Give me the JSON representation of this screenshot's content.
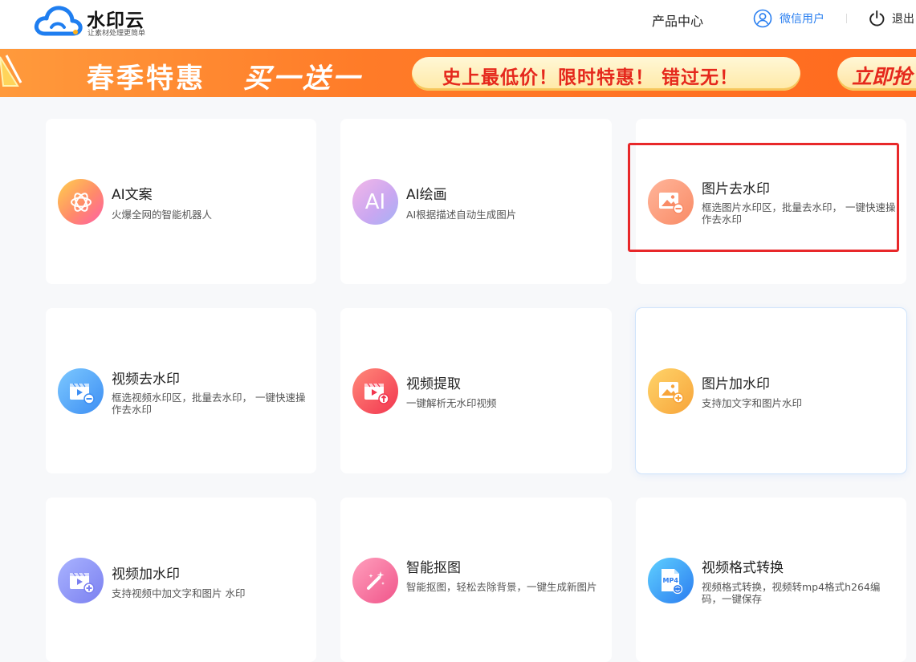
{
  "header": {
    "logo_title": "水印云",
    "logo_subtitle": "让素材处理更简单",
    "nav_product_center": "产品中心",
    "user_name": "微信用户",
    "logout_label": "退出"
  },
  "banner": {
    "title": "春季特惠",
    "subtitle": "买一送一",
    "pill_text": "史上最低价！限时特惠！ 错过无！",
    "cta_label": "立即抢",
    "background_color": "#ff7b28",
    "accent_color": "#e5281c"
  },
  "cards": [
    {
      "title": "AI文案",
      "desc": "火爆全网的智能机器人",
      "icon": "chatgpt-knot-icon"
    },
    {
      "title": "AI绘画",
      "desc": "AI根据描述自动生成图片",
      "icon": "ai-letters-icon",
      "icon_text": "AI"
    },
    {
      "title": "图片去水印",
      "desc": "框选图片水印区，批量去水印， 一键快速操作去水印",
      "icon": "image-remove-icon"
    },
    {
      "title": "视频去水印",
      "desc": "框选视频水印区，批量去水印， 一键快速操作去水印",
      "icon": "video-remove-icon"
    },
    {
      "title": "视频提取",
      "desc": "一键解析无水印视频",
      "icon": "video-extract-icon"
    },
    {
      "title": "图片加水印",
      "desc": "支持加文字和图片水印",
      "icon": "image-add-icon"
    },
    {
      "title": "视频加水印",
      "desc": "支持视频中加文字和图片 水印",
      "icon": "video-add-icon"
    },
    {
      "title": "智能抠图",
      "desc": "智能抠图，轻松去除背景，一键生成新图片",
      "icon": "magic-wand-icon"
    },
    {
      "title": "视频格式转换",
      "desc": "视频格式转换，视频转mp4格式h264编码，一键保存",
      "icon": "mp4-file-icon",
      "icon_text": "MP4"
    }
  ],
  "highlight_color": "#e8282a",
  "brand_color": "#2a7ff0"
}
